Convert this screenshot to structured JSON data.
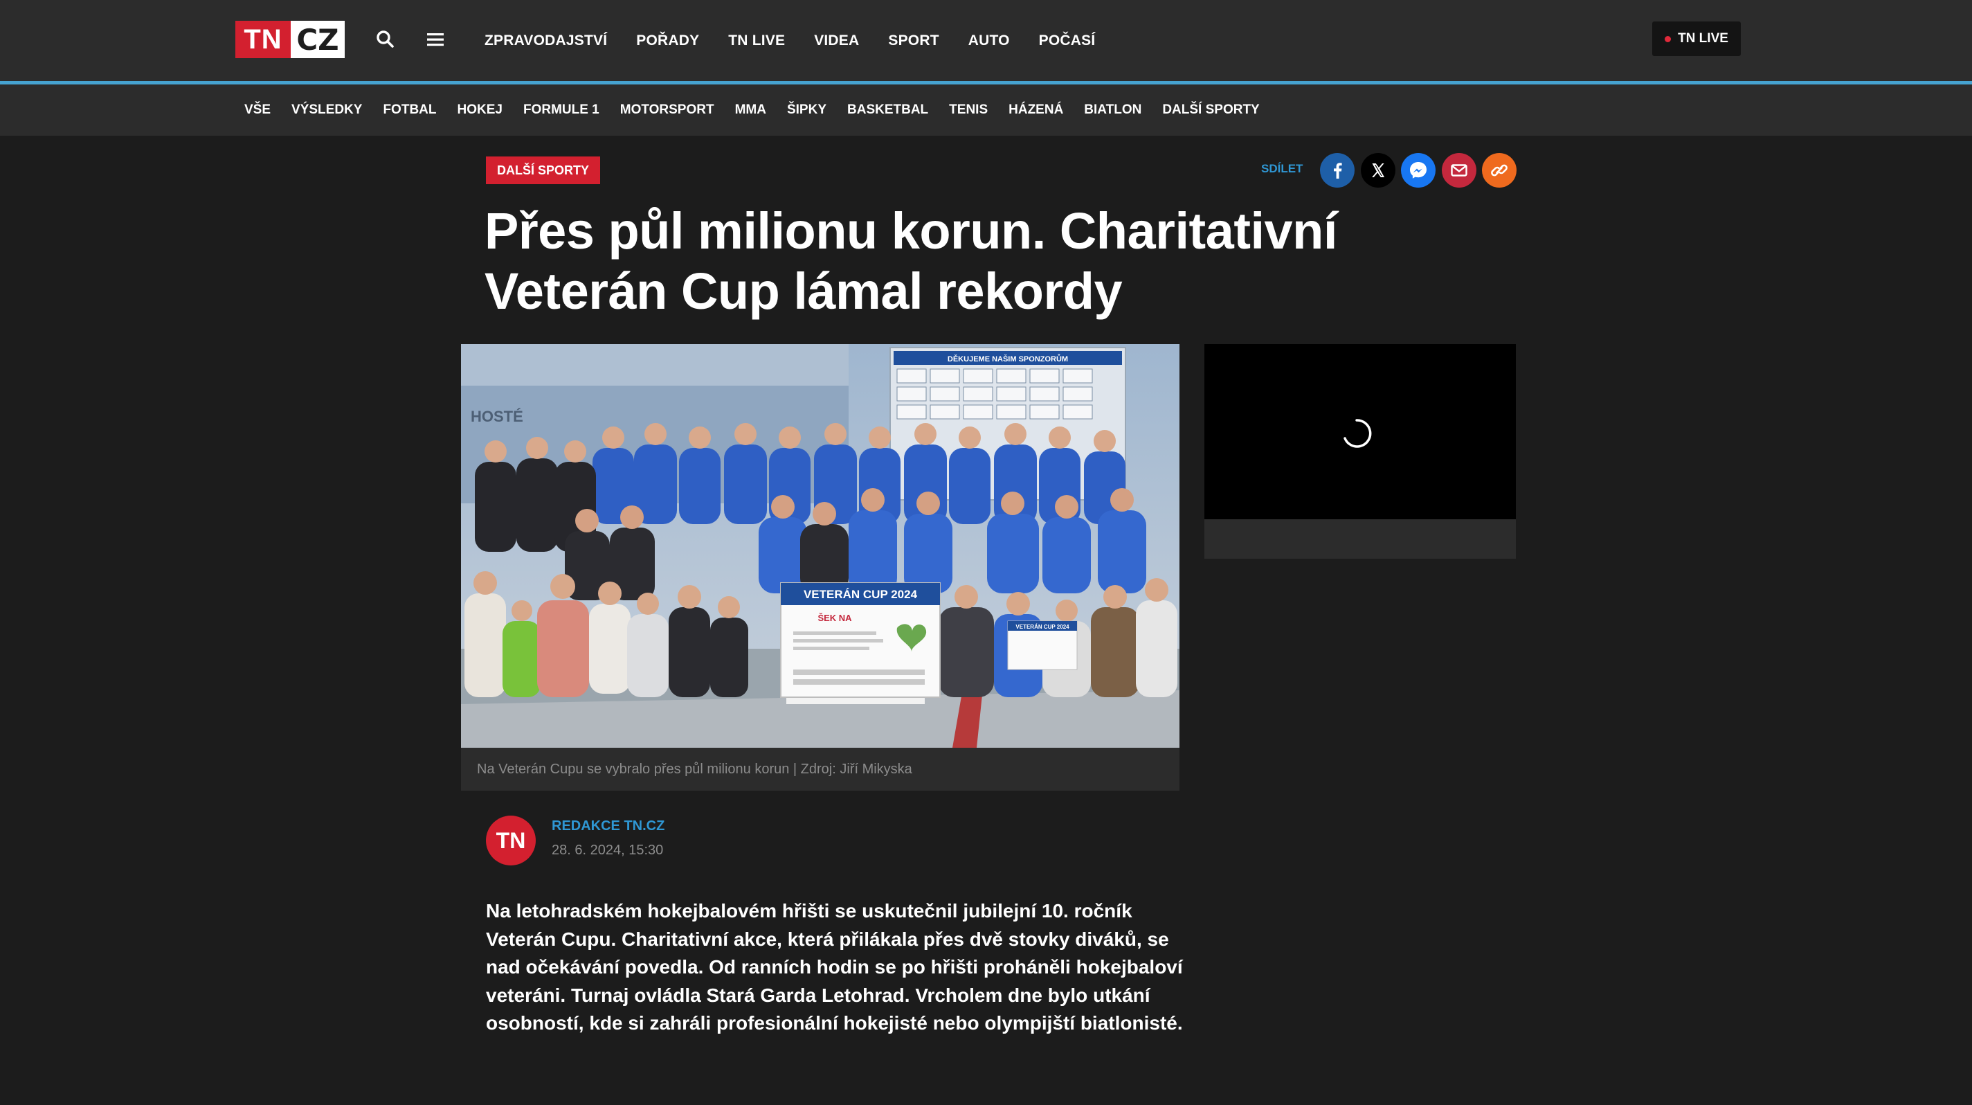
{
  "header": {
    "logo": {
      "tn": "TN",
      "cz": "CZ"
    },
    "nav": [
      "ZPRAVODAJSTVÍ",
      "POŘADY",
      "TN LIVE",
      "VIDEA",
      "SPORT",
      "AUTO",
      "POČASÍ"
    ],
    "live_button": "TN LIVE"
  },
  "subnav": [
    "VŠE",
    "VÝSLEDKY",
    "FOTBAL",
    "HOKEJ",
    "FORMULE 1",
    "MOTORSPORT",
    "MMA",
    "ŠIPKY",
    "BASKETBAL",
    "TENIS",
    "HÁZENÁ",
    "BIATLON",
    "DALŠÍ SPORTY"
  ],
  "article": {
    "category": "DALŠÍ SPORTY",
    "share_label": "SDÍLET",
    "share_buttons": [
      {
        "name": "facebook-icon",
        "color": "#1e5fa8"
      },
      {
        "name": "x-icon",
        "color": "#000000"
      },
      {
        "name": "messenger-icon",
        "color": "#1877f2"
      },
      {
        "name": "email-icon",
        "color": "#c4283d"
      },
      {
        "name": "link-icon",
        "color": "#ef6a1e"
      }
    ],
    "title": "Přes půl milionu korun. Charitativní Veterán Cup lámal rekordy",
    "photo": {
      "sponsor_wall": "DĚKUJEME NAŠIM SPONZORŮM",
      "wall_label": "HOSTÉ",
      "check_title": "VETERÁN CUP 2024",
      "check_text": "ŠEK NA",
      "small_check": "VETERÁN CUP 2024"
    },
    "caption": "Na Veterán Cupu se vybralo přes půl milionu korun | Zdroj: Jiří Mikyska",
    "author": {
      "avatar": "TN",
      "name": "REDAKCE TN.CZ",
      "date": "28. 6. 2024, 15:30"
    },
    "perex": "Na letohradském hokejbalovém hřišti se uskutečnil jubilejní 10. ročník Veterán Cupu. Charitativní akce, která přilákala přes dvě stovky diváků, se nad očekávání povedla. Od ranních hodin se po hřišti proháněli hokejbaloví veteráni. Turnaj ovládla Stará Garda Letohrad. Vrcholem dne bylo utkání osobností, kde si zahráli profesionální hokejisté nebo olympijští biatlonisté."
  },
  "colors": {
    "brand_red": "#d3202f",
    "accent_blue": "#46a3d1",
    "link_blue": "#2f97d4",
    "background": "#1c1c1c",
    "panel": "#2c2c2c"
  }
}
